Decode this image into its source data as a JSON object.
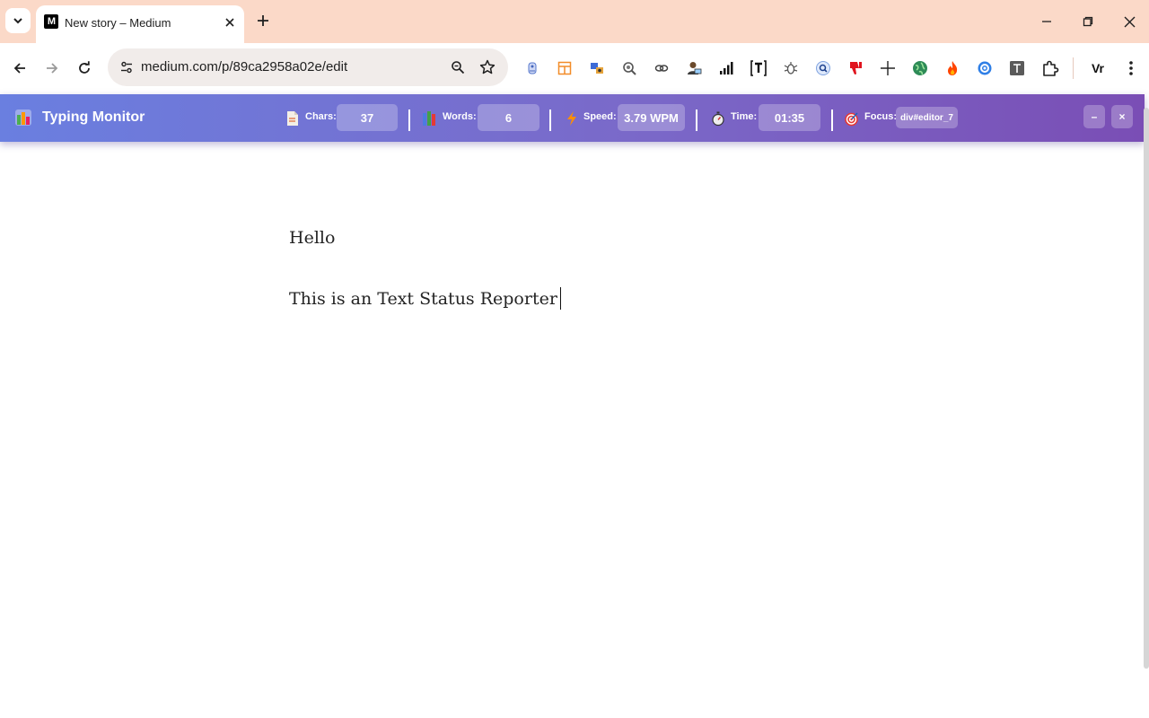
{
  "browser": {
    "tab_title": "New story – Medium",
    "tab_favicon_text": "M",
    "url": "medium.com/p/89ca2958a02e/edit",
    "profile_label": "Vr",
    "extensions": [
      "grammar-bot-icon",
      "layout-extension-icon",
      "tool-extension-icon",
      "spy-extension-icon",
      "link-extension-icon",
      "dev-avatar-extension-icon",
      "signal-bars-icon",
      "text-extension-icon",
      "bug-extension-icon",
      "lens-extension-icon",
      "thumbs-down-extension-icon",
      "crosshair-extension-icon",
      "globe-extension-icon",
      "fire-extension-icon",
      "gear-extension-icon",
      "t-box-extension-icon",
      "puzzle-icon"
    ]
  },
  "monitor": {
    "title": "Typing Monitor",
    "chars_label": "Chars:",
    "chars_value": "37",
    "words_label": "Words:",
    "words_value": "6",
    "speed_label": "Speed:",
    "speed_value": "3.79 WPM",
    "time_label": "Time:",
    "time_value": "01:35",
    "focus_label": "Focus:",
    "focus_value": "div#editor_7",
    "minimize_label": "–",
    "close_label": "×",
    "accent_start": "#6a7fe0",
    "accent_end": "#7a4eb5"
  },
  "editor": {
    "paragraph_1": "Hello",
    "paragraph_2": "This is an Text Status Reporter"
  }
}
